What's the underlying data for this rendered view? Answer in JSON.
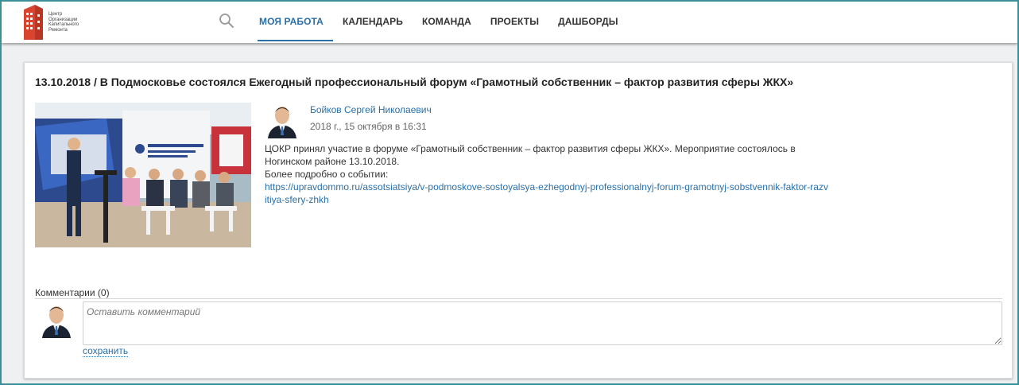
{
  "header": {
    "logo_text": [
      "Центр",
      "Организации",
      "Капитального",
      "Ремонта"
    ],
    "nav": [
      {
        "label": "МОЯ РАБОТА",
        "active": true
      },
      {
        "label": "КАЛЕНДАРЬ",
        "active": false
      },
      {
        "label": "КОМАНДА",
        "active": false
      },
      {
        "label": "ПРОЕКТЫ",
        "active": false
      },
      {
        "label": "ДАШБОРДЫ",
        "active": false
      }
    ]
  },
  "post": {
    "title": "13.10.2018 / В Подмосковье состоялся Ежегодный профессиональный форум «Грамотный собственник – фактор развития сферы ЖКХ»",
    "author": "Бойков Сергей Николаевич",
    "date": "2018 г., 15 октября в 16:31",
    "body_line1": "ЦОКР принял участие в форуме «Грамотный собственник – фактор развития сферы ЖКХ». Мероприятие состоялось в Ногинском районе 13.10.2018.",
    "body_line2": "Более подробно о событии:",
    "link": "https://upravdommo.ru/assotsiatsiya/v-podmoskove-sostoyalsya-ezhegodnyj-professionalnyj-forum-gramotnyj-sobstvennik-faktor-razvitiya-sfery-zhkh"
  },
  "comments": {
    "heading": "Комментарии (0)",
    "placeholder": "Оставить комментарий",
    "save_label": "сохранить"
  },
  "colors": {
    "accent": "#2a6fa8",
    "frame": "#3c8f96",
    "logo_red": "#d9442f"
  }
}
